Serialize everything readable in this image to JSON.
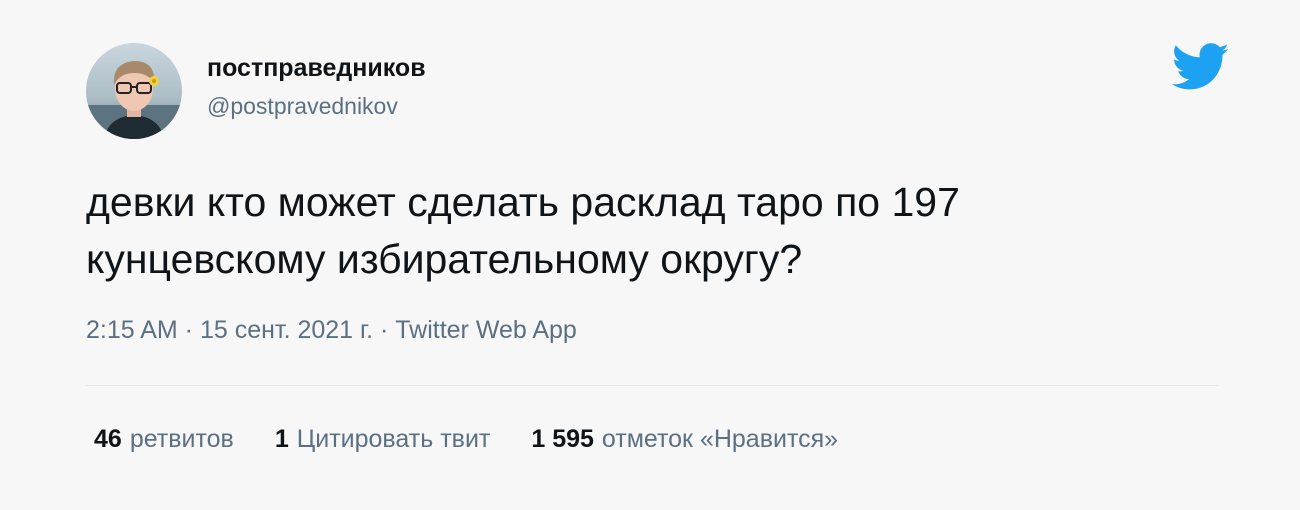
{
  "tweet": {
    "display_name": "постправедников",
    "handle": "@postpravednikov",
    "text": "девки кто может сделать расклад таро по 197\nкунцевскому избирательному округу?",
    "meta": "2:15 AM · 15 сент. 2021 г. · Twitter Web App",
    "stats": [
      {
        "count": "46",
        "label": "ретвитов"
      },
      {
        "count": "1",
        "label": "Цитировать твит"
      },
      {
        "count": "1 595",
        "label": "отметок «Нравится»"
      }
    ]
  },
  "icons": {
    "brand": "twitter-bird-icon"
  },
  "colors": {
    "background": "#f7f7f7",
    "brand": "#1da1f2",
    "primary_text": "#0f1419",
    "secondary_text": "#5b7083"
  }
}
